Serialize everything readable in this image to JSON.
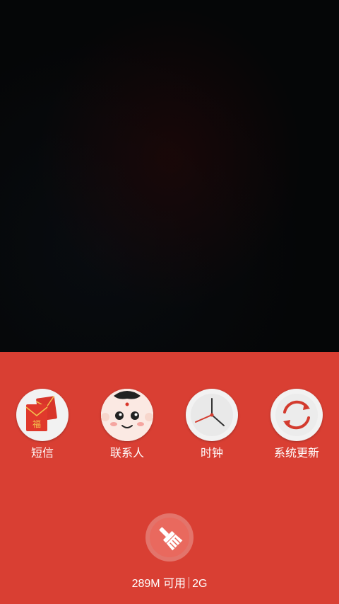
{
  "apps": [
    {
      "label": "短信",
      "icon": "red-envelope-icon"
    },
    {
      "label": "联系人",
      "icon": "baby-face-icon"
    },
    {
      "label": "时钟",
      "icon": "clock-icon"
    },
    {
      "label": "系统更新",
      "icon": "refresh-icon"
    }
  ],
  "clean_button": {
    "icon": "broom-icon"
  },
  "memory": {
    "available": "289M 可用",
    "total": "2G"
  },
  "colors": {
    "panel": "#d93f33",
    "clean_button": "#e9695e",
    "accent_red": "#d33b2e"
  }
}
